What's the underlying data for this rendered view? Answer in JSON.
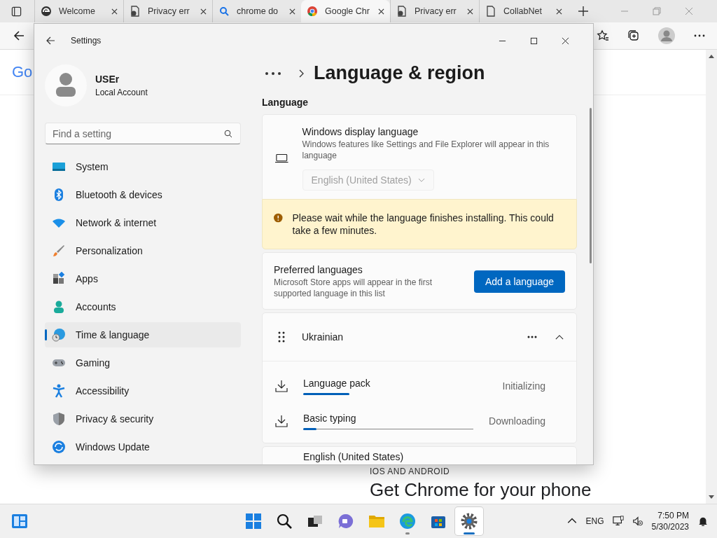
{
  "browser": {
    "tabs": [
      {
        "label": "Welcome",
        "selected": false
      },
      {
        "label": "Privacy err",
        "selected": false
      },
      {
        "label": "chrome do",
        "selected": false
      },
      {
        "label": "Google Chr",
        "selected": true
      },
      {
        "label": "Privacy err",
        "selected": false
      },
      {
        "label": "CollabNet",
        "selected": false
      }
    ],
    "page": {
      "logo": "Go",
      "eyebrow": "IOS AND ANDROID",
      "headline": "Get Chrome for your phone"
    }
  },
  "settings": {
    "title": "Settings",
    "user": {
      "name": "USEr",
      "account": "Local Account"
    },
    "search": {
      "placeholder": "Find a setting"
    },
    "nav": [
      {
        "label": "System",
        "selected": false
      },
      {
        "label": "Bluetooth & devices",
        "selected": false
      },
      {
        "label": "Network & internet",
        "selected": false
      },
      {
        "label": "Personalization",
        "selected": false
      },
      {
        "label": "Apps",
        "selected": false
      },
      {
        "label": "Accounts",
        "selected": false
      },
      {
        "label": "Time & language",
        "selected": true
      },
      {
        "label": "Gaming",
        "selected": false
      },
      {
        "label": "Accessibility",
        "selected": false
      },
      {
        "label": "Privacy & security",
        "selected": false
      },
      {
        "label": "Windows Update",
        "selected": false
      }
    ],
    "page_title": "Language & region",
    "section": "Language",
    "display_language": {
      "title": "Windows display language",
      "description": "Windows features like Settings and File Explorer will appear in this language",
      "dropdown": {
        "value": "English (United States)",
        "disabled": true
      }
    },
    "notice": "Please wait while the language finishes installing. This could take a few minutes.",
    "preferred": {
      "title": "Preferred languages",
      "description": "Microsoft Store apps will appear in the first supported language in this list",
      "button": "Add a language"
    },
    "languages": [
      {
        "name": "Ukrainian",
        "expanded": true,
        "features": [
          {
            "name": "Language pack",
            "status": "Initializing",
            "level": 0.27,
            "show_track": false
          },
          {
            "name": "Basic typing",
            "status": "Downloading",
            "level": 0.08,
            "show_track": true
          }
        ]
      },
      {
        "name": "English (United States)"
      }
    ]
  },
  "taskbar": {
    "apps": [
      {
        "running": false,
        "selected": false
      },
      {
        "running": false,
        "selected": false
      },
      {
        "running": false,
        "selected": false
      },
      {
        "running": false,
        "selected": false
      },
      {
        "running": false,
        "selected": false
      },
      {
        "running": true,
        "selected": false
      },
      {
        "running": false,
        "selected": false
      },
      {
        "running": true,
        "selected": true
      }
    ],
    "language": "ENG",
    "time": "7:50 PM",
    "date": "5/30/2023"
  }
}
